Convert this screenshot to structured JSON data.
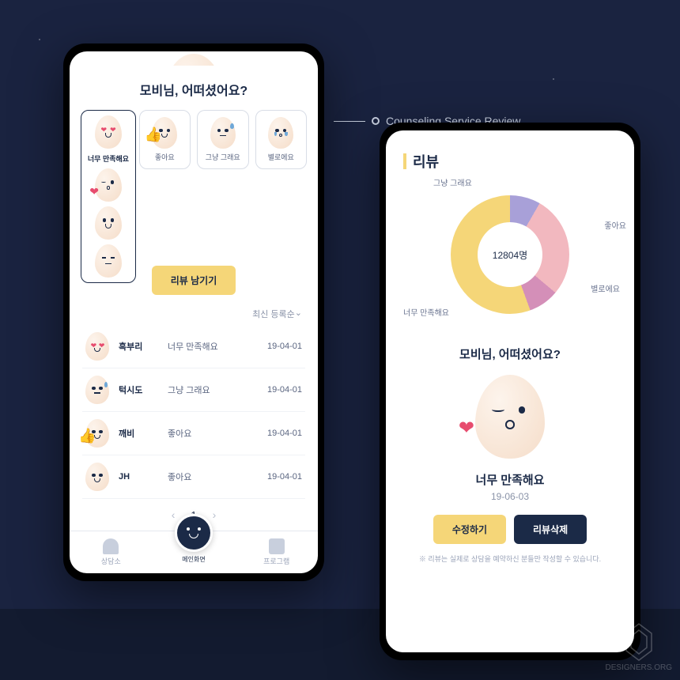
{
  "annotation": "Counseling Service Review",
  "phone1": {
    "title": "모비님, 어떠셨어요?",
    "moods": [
      {
        "label": "너무 만족해요",
        "face": "heart"
      },
      {
        "label": "좋아요",
        "face": "thumb"
      },
      {
        "label": "그냥 그래요",
        "face": "sweat"
      },
      {
        "label": "별로에요",
        "face": "cry"
      }
    ],
    "dropdown_extra": [
      {
        "face": "kiss"
      },
      {
        "face": "smile"
      },
      {
        "face": "squint"
      }
    ],
    "write_review_btn": "리뷰 남기기",
    "sort_label": "최신 등록순",
    "reviews": [
      {
        "face": "heart",
        "name": "흑부리",
        "rating": "너무 만족해요",
        "date": "19-04-01"
      },
      {
        "face": "sweat",
        "name": "턱시도",
        "rating": "그냥 그래요",
        "date": "19-04-01"
      },
      {
        "face": "thumb",
        "name": "깨비",
        "rating": "좋아요",
        "date": "19-04-01"
      },
      {
        "face": "smile",
        "name": "JH",
        "rating": "좋아요",
        "date": "19-04-01"
      }
    ],
    "page": "1",
    "tabs": {
      "left": "상담소",
      "center": "메인화면",
      "right": "프로그램"
    }
  },
  "phone2": {
    "section_title": "리뷰",
    "donut_center": "12804명",
    "donut_labels": {
      "soso": "그냥 그래요",
      "good": "좋아요",
      "bad": "별로에요",
      "verygood": "너무 만족해요"
    },
    "review_title": "모비님, 어떠셨어요?",
    "my_rating": "너무 만족해요",
    "my_date": "19-06-03",
    "edit_btn": "수정하기",
    "delete_btn": "리뷰삭제",
    "disclaimer": "※ 리뷰는 실제로 상담을 예약하신 분들만 작성할 수 있습니다."
  },
  "chart_data": {
    "type": "pie",
    "title": "리뷰",
    "total_label": "12804명",
    "series": [
      {
        "name": "그냥 그래요",
        "value": 8,
        "color": "#a8a0d8"
      },
      {
        "name": "좋아요",
        "value": 28,
        "color": "#f2b8bf"
      },
      {
        "name": "별로에요",
        "value": 8,
        "color": "#d48fb8"
      },
      {
        "name": "너무 만족해요",
        "value": 56,
        "color": "#f5d678"
      }
    ]
  },
  "watermark": "DESIGNERS.ORG"
}
